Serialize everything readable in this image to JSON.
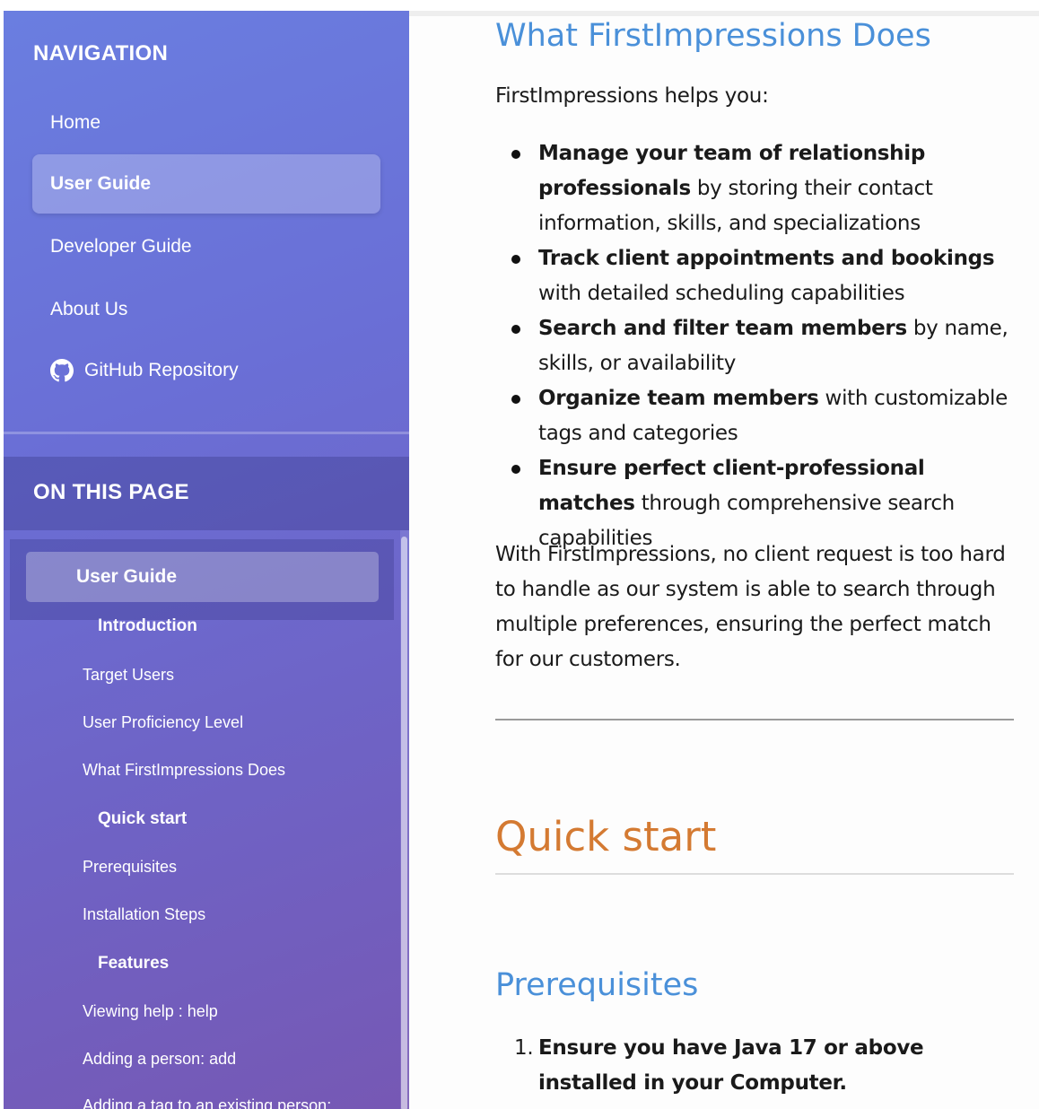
{
  "sidebar": {
    "nav_heading": "NAVIGATION",
    "nav_items": [
      {
        "label": "Home",
        "active": false
      },
      {
        "label": "User Guide",
        "active": true
      },
      {
        "label": "Developer Guide",
        "active": false
      },
      {
        "label": "About Us",
        "active": false
      },
      {
        "label": "GitHub Repository",
        "active": false,
        "icon": "github-icon"
      }
    ],
    "toc_heading": "ON THIS PAGE",
    "toc_active": "User Guide",
    "toc_items": [
      {
        "label": "Introduction",
        "level": 2
      },
      {
        "label": "Target Users",
        "level": 3
      },
      {
        "label": "User Proficiency Level",
        "level": 3
      },
      {
        "label": "What FirstImpressions Does",
        "level": 3
      },
      {
        "label": "Quick start",
        "level": 2
      },
      {
        "label": "Prerequisites",
        "level": 3
      },
      {
        "label": "Installation Steps",
        "level": 3
      },
      {
        "label": "Features",
        "level": 2
      },
      {
        "label": "Viewing help : help",
        "level": 3
      },
      {
        "label": "Adding a person: add",
        "level": 3
      },
      {
        "label": "Adding a tag to an existing person:",
        "level": 3
      }
    ]
  },
  "main": {
    "section_title": "What FirstImpressions Does",
    "intro": "FirstImpressions helps you:",
    "bullets": [
      {
        "bold": "Manage your team of relationship professionals",
        "rest": " by storing their contact information, skills, and specializations"
      },
      {
        "bold": "Track client appointments and bookings",
        "rest": " with detailed scheduling capabilities"
      },
      {
        "bold": "Search and filter team members",
        "rest": " by name, skills, or availability"
      },
      {
        "bold": "Organize team members",
        "rest": " with customizable tags and categories"
      },
      {
        "bold": "Ensure perfect client-professional matches",
        "rest": " through comprehensive search capabilities"
      }
    ],
    "closing": "With FirstImpressions, no client request is too hard to handle as our system is able to search through multiple preferences, ensuring the perfect match for our customers.",
    "quick_start_title": "Quick start",
    "prerequisites_title": "Prerequisites",
    "prereq_items": [
      {
        "num": "1.",
        "text": "Ensure you have Java 17 or above installed in your Computer."
      }
    ]
  },
  "colors": {
    "accent_heading": "#4a90d9",
    "quick_start_heading": "#d47a32",
    "sidebar_gradient_start": "#6a7ee0",
    "sidebar_gradient_end": "#7658b4"
  }
}
